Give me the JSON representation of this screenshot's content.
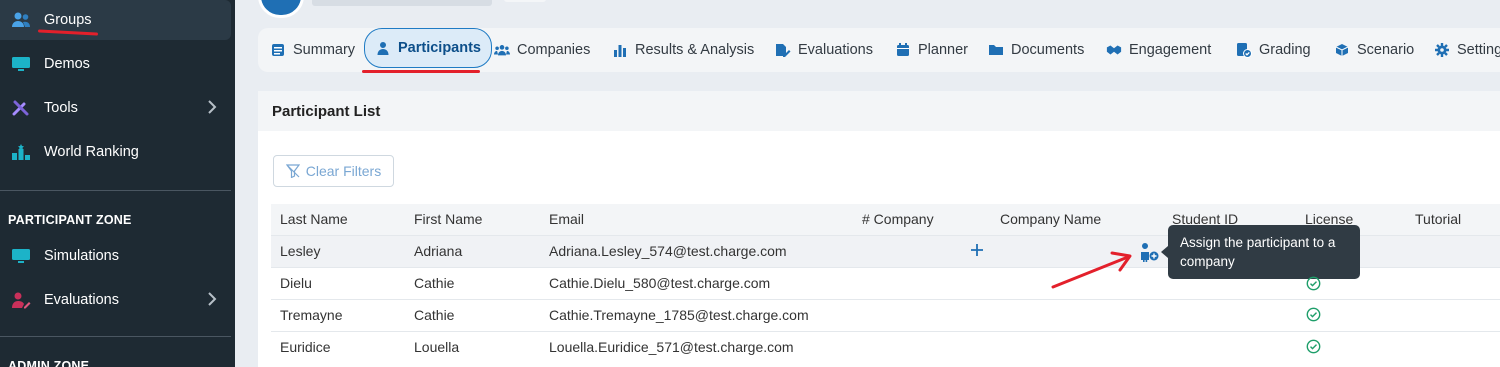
{
  "sidebar": {
    "items": [
      {
        "label": "Groups",
        "icon": "users-icon"
      },
      {
        "label": "Demos",
        "icon": "monitor-icon"
      },
      {
        "label": "Tools",
        "icon": "tools-icon"
      },
      {
        "label": "World Ranking",
        "icon": "podium-icon"
      }
    ],
    "participant_zone": {
      "title": "PARTICIPANT ZONE",
      "items": [
        {
          "label": "Simulations",
          "icon": "monitor-icon"
        },
        {
          "label": "Evaluations",
          "icon": "user-edit-icon"
        }
      ]
    },
    "admin_zone": {
      "title": "ADMIN ZONE"
    }
  },
  "tabs": [
    {
      "label": "Summary",
      "icon": "list-icon"
    },
    {
      "label": "Participants",
      "icon": "user-icon",
      "active": true
    },
    {
      "label": "Companies",
      "icon": "users-icon"
    },
    {
      "label": "Results & Analysis",
      "icon": "bar-chart-icon"
    },
    {
      "label": "Evaluations",
      "icon": "edit-icon"
    },
    {
      "label": "Planner",
      "icon": "calendar-icon"
    },
    {
      "label": "Documents",
      "icon": "folder-icon"
    },
    {
      "label": "Engagement",
      "icon": "handshake-icon"
    },
    {
      "label": "Grading",
      "icon": "grading-icon"
    },
    {
      "label": "Scenario",
      "icon": "box-icon"
    },
    {
      "label": "Settings",
      "icon": "gear-icon"
    }
  ],
  "panel": {
    "title": "Participant List",
    "clear_filters": "Clear Filters"
  },
  "table": {
    "columns": [
      "Last Name",
      "First Name",
      "Email",
      "# Company",
      "Company Name",
      "Student ID",
      "License",
      "Tutorial"
    ],
    "rows": [
      {
        "last": "Lesley",
        "first": "Adriana",
        "email": "Adriana.Lesley_574@test.charge.com",
        "license": false
      },
      {
        "last": "Dielu",
        "first": "Cathie",
        "email": "Cathie.Dielu_580@test.charge.com",
        "license": true
      },
      {
        "last": "Tremayne",
        "first": "Cathie",
        "email": "Cathie.Tremayne_1785@test.charge.com",
        "license": true
      },
      {
        "last": "Euridice",
        "first": "Louella",
        "email": "Louella.Euridice_571@test.charge.com",
        "license": true
      }
    ]
  },
  "tooltip": {
    "text": "Assign the participant to a company"
  },
  "colors": {
    "accent": "#1f6fb4",
    "annotation": "#e3202b",
    "sidebar": "#1e2a33",
    "check": "#1e9e6a"
  }
}
